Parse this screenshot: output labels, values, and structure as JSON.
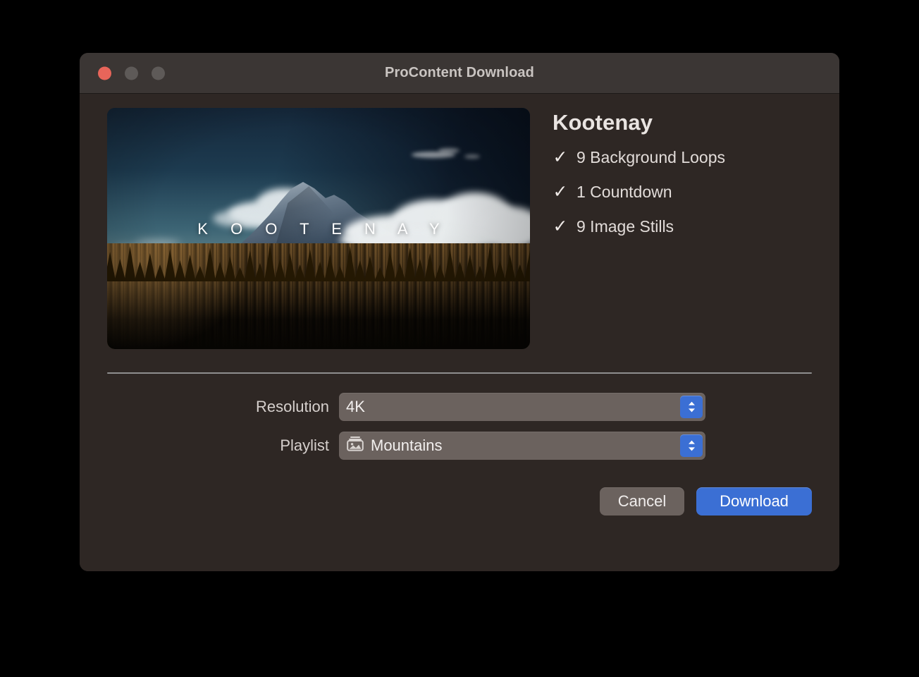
{
  "window": {
    "title": "ProContent Download",
    "traffic_lights": [
      {
        "name": "close",
        "color": "#e8655a"
      },
      {
        "name": "minimize",
        "color": "#5e5a58"
      },
      {
        "name": "zoom",
        "color": "#5e5a58"
      }
    ]
  },
  "preview": {
    "wordmark": "K O O T E N A Y",
    "alt": "Mountain peak above a conifer forest at dusk"
  },
  "details": {
    "pack_title": "Kootenay",
    "features": [
      {
        "check": "✓",
        "label": "9 Background Loops"
      },
      {
        "check": "✓",
        "label": "1 Countdown"
      },
      {
        "check": "✓",
        "label": "9 Image Stills"
      }
    ]
  },
  "form": {
    "resolution": {
      "label": "Resolution",
      "value": "4K"
    },
    "playlist": {
      "label": "Playlist",
      "value": "Mountains",
      "icon": "photo-library-icon"
    }
  },
  "buttons": {
    "cancel": "Cancel",
    "download": "Download"
  },
  "colors": {
    "accent": "#3b6fd4",
    "window_body": "#2e2724",
    "titlebar": "#3b3634",
    "control": "#6b625e",
    "separator": "#8e8e8e",
    "close_red": "#e8655a"
  }
}
